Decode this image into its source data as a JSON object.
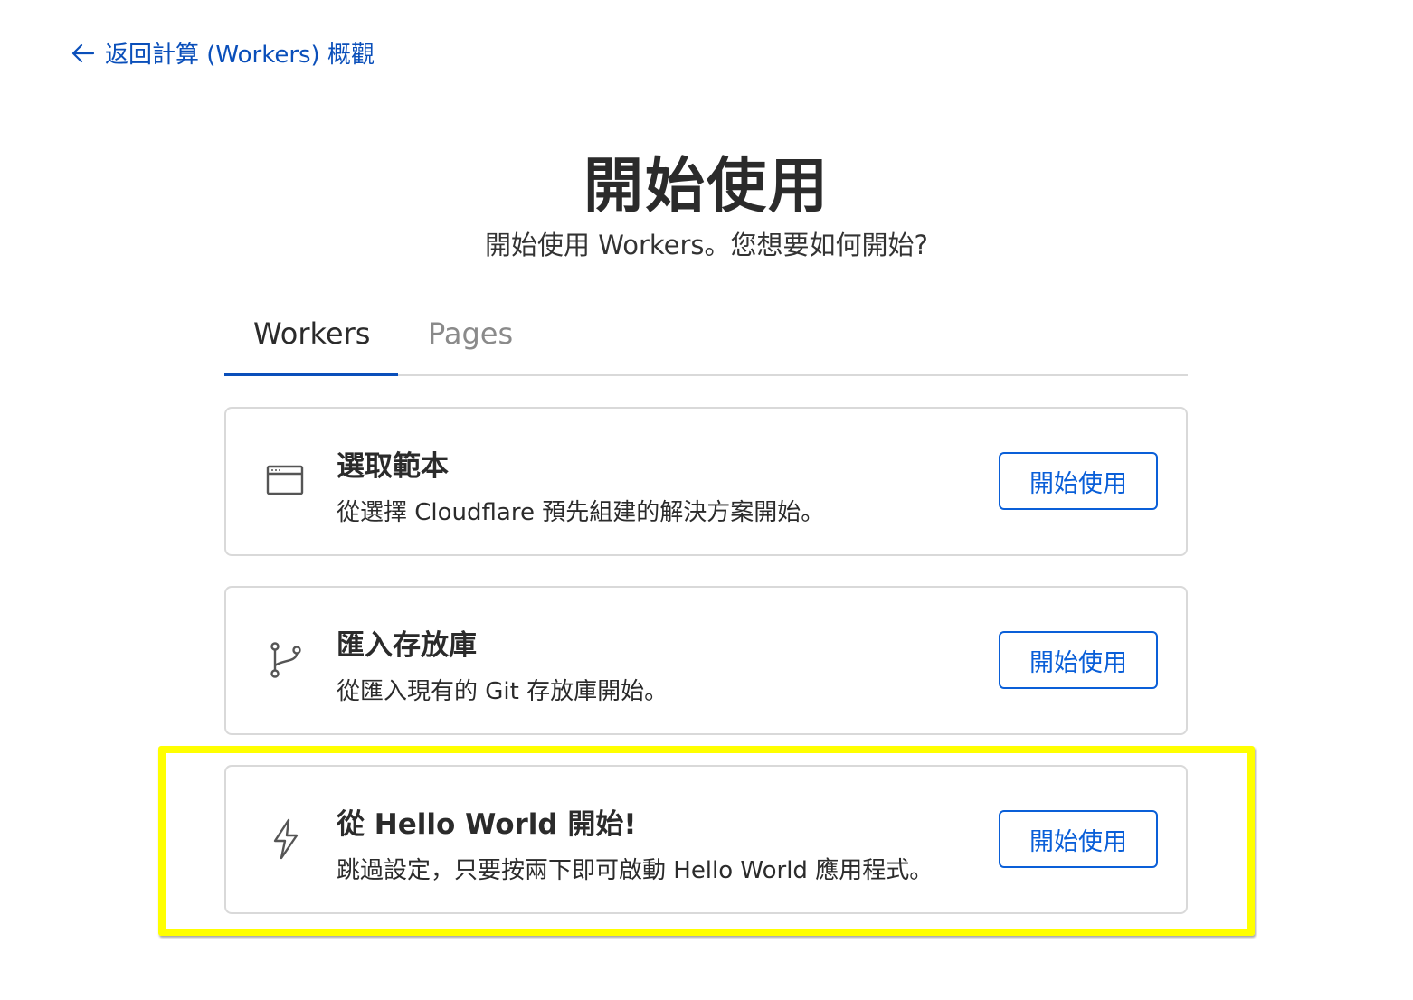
{
  "back_link": {
    "label": "返回計算 (Workers) 概觀",
    "icon": "arrow-left-icon"
  },
  "header": {
    "title": "開始使用",
    "subtitle": "開始使用 Workers。您想要如何開始?"
  },
  "tabs": [
    {
      "label": "Workers",
      "active": true
    },
    {
      "label": "Pages",
      "active": false
    }
  ],
  "options": [
    {
      "icon": "browser-window-icon",
      "title": "選取範本",
      "description": "從選擇 Cloudflare 預先組建的解決方案開始。",
      "button": "開始使用"
    },
    {
      "icon": "git-branch-icon",
      "title": "匯入存放庫",
      "description": "從匯入現有的 Git 存放庫開始。",
      "button": "開始使用"
    },
    {
      "icon": "lightning-bolt-icon",
      "title": "從 Hello World 開始!",
      "description": "跳過設定，只要按兩下即可啟動 Hello World 應用程式。",
      "button": "開始使用",
      "highlighted": true
    }
  ],
  "colors": {
    "link": "#0a4fba",
    "button": "#0a5fd8",
    "highlight": "#ffff00"
  }
}
